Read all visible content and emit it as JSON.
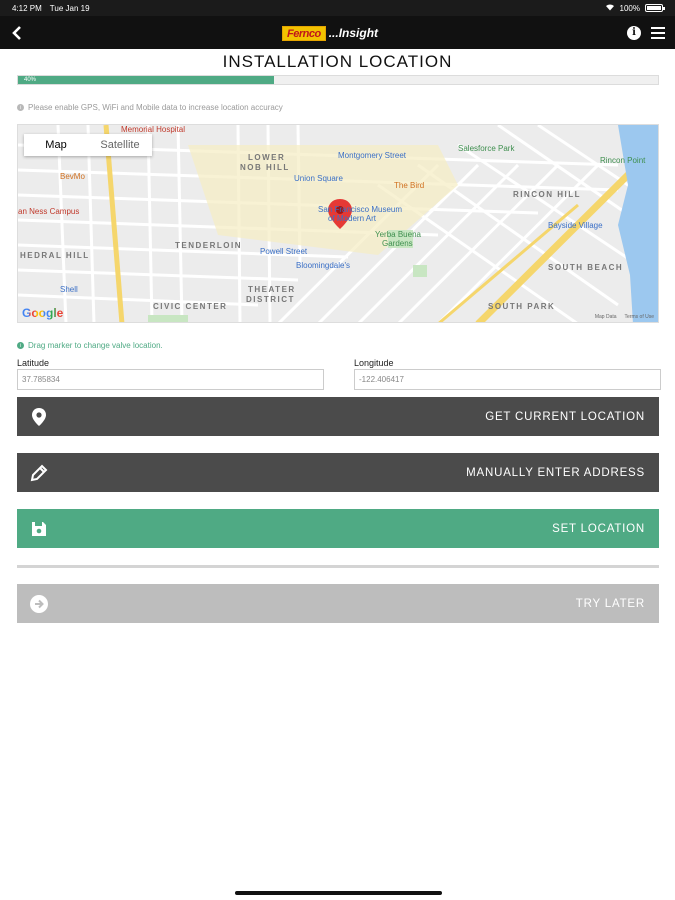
{
  "status_bar": {
    "time": "4:12 PM",
    "date": "Tue Jan 19",
    "battery": "100%"
  },
  "nav": {
    "back_glyph": "‹",
    "brand_logo": "Fernco",
    "brand_suffix": "...Insight",
    "info_glyph": "i"
  },
  "page": {
    "title": "INSTALLATION LOCATION"
  },
  "progress": {
    "percent": 40,
    "label": "40%"
  },
  "hints": {
    "gps": "Please enable GPS, WiFi and Mobile data to increase location accuracy",
    "drag": "Drag marker to change valve location."
  },
  "map": {
    "tabs": {
      "map": "Map",
      "satellite": "Satellite"
    },
    "areas": [
      "LOWER",
      "NOB HILL",
      "TENDERLOIN",
      "THEATER",
      "DISTRICT",
      "CIVIC CENTER",
      "RINCON HILL",
      "SOUTH BEACH",
      "SOUTH PARK",
      "HEDRAL HILL"
    ],
    "pois": [
      "Memorial Hospital",
      "Montgomery Street",
      "Salesforce Park",
      "Rincon Point",
      "Union Square",
      "The Bird",
      "San Francisco Museum",
      "of Modern Art",
      "Yerba Buena",
      "Gardens",
      "Powell Street",
      "Bloomingdale's",
      "BevMo",
      "an Ness Campus",
      "Bayside Village",
      "Shell"
    ],
    "google": "Google",
    "map_data": "Map Data",
    "terms": "Terms of Use"
  },
  "latitude": {
    "label": "Latitude",
    "value": "37.785834"
  },
  "longitude": {
    "label": "Longitude",
    "value": "-122.406417"
  },
  "buttons": {
    "current_location": "GET CURRENT LOCATION",
    "manual_address": "MANUALLY ENTER ADDRESS",
    "set_location": "SET LOCATION",
    "try_later": "TRY LATER"
  },
  "colors": {
    "accent_green": "#4faa84",
    "dark_button": "#4b4b4b",
    "disabled_button": "#bdbdbd",
    "marker_red": "#e53935"
  },
  "icons": {
    "back": "chevron-left-icon",
    "info": "info-icon",
    "menu": "hamburger-menu-icon",
    "location": "location-pin-icon",
    "pencil": "pencil-icon",
    "save": "floppy-disk-icon",
    "arrow": "arrow-right-circle-icon",
    "marker": "map-marker-icon"
  }
}
